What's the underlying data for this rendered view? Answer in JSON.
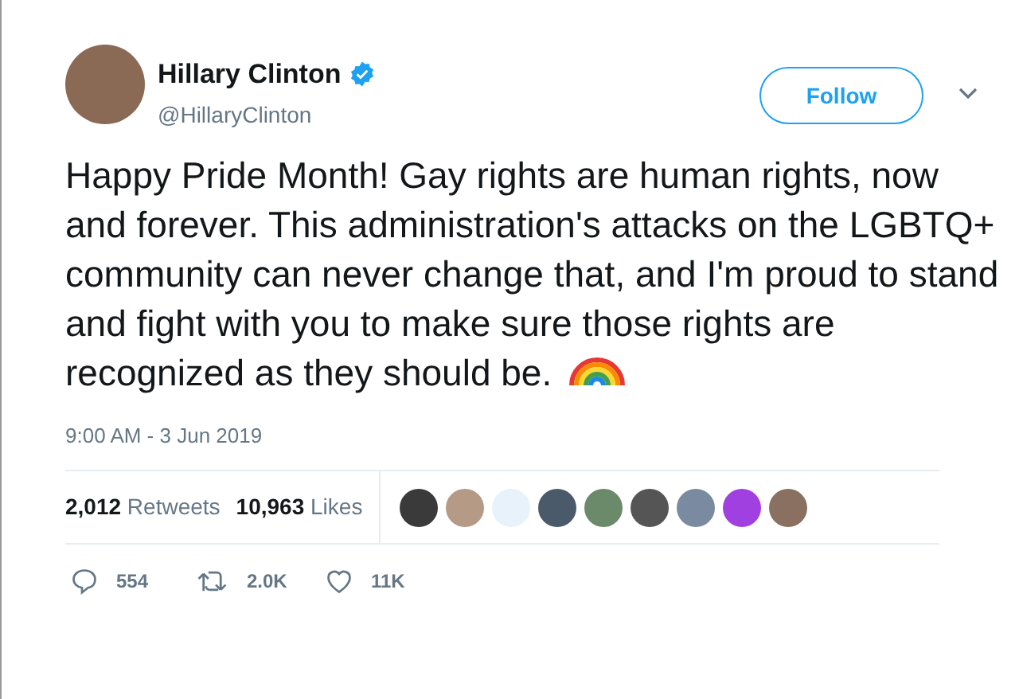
{
  "author": {
    "name": "Hillary Clinton",
    "verified": true,
    "handle": "@HillaryClinton"
  },
  "follow_button": {
    "label": "Follow"
  },
  "tweet": {
    "text": "Happy Pride Month! Gay rights are human rights, now and forever. This administration's attacks on the LGBTQ+ community can never change that, and I'm proud to stand and fight with you to make sure those rights are recognized as they should be."
  },
  "timestamp": "9:00 AM - 3 Jun 2019",
  "stats": [
    {
      "count": "2,012",
      "label": "Retweets"
    },
    {
      "count": "10,963",
      "label": "Likes"
    }
  ],
  "liker_avatars": [
    {
      "color": "#3a3a3a"
    },
    {
      "color": "#b59a86"
    },
    {
      "color": "#e8f2fb"
    },
    {
      "color": "#4a5a6a"
    },
    {
      "color": "#6a8a6a"
    },
    {
      "color": "#555555"
    },
    {
      "color": "#7a8aa0"
    },
    {
      "color": "#a040e0"
    },
    {
      "color": "#8a7060"
    }
  ],
  "actions": [
    {
      "kind": "reply",
      "count": "554"
    },
    {
      "kind": "retweet",
      "count": "2.0K"
    },
    {
      "kind": "like",
      "count": "11K"
    }
  ]
}
